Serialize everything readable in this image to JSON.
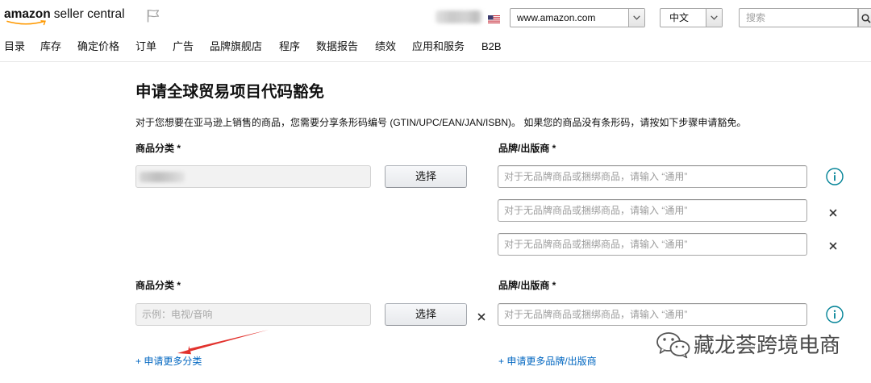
{
  "colors": {
    "link": "#0066c0",
    "info_icon": "#008296",
    "annotation_arrow": "#e2322d",
    "logo_smile": "#ff9900"
  },
  "icons": {
    "report_flag": "flag-icon",
    "marketplace_flag": "us-flag-icon",
    "dropdown": "chevron-down-icon",
    "search": "search-icon",
    "info": "info-icon",
    "remove": "close-icon",
    "watermark": "wechat-icon"
  },
  "header": {
    "logo": {
      "brand": "amazon",
      "product": "seller central"
    },
    "marketplace": "www.amazon.com",
    "language": "中文",
    "search_placeholder": "搜索"
  },
  "nav": {
    "items": [
      "目录",
      "库存",
      "确定价格",
      "订单",
      "广告",
      "品牌旗舰店",
      "程序",
      "数据报告",
      "绩效",
      "应用和服务",
      "B2B"
    ]
  },
  "page": {
    "title": "申请全球贸易项目代码豁免",
    "description": "对于您想要在亚马逊上销售的商品，您需要分享条形码编号 (GTIN/UPC/EAN/JAN/ISBN)。 如果您的商品没有条形码，请按如下步骤申请豁免。"
  },
  "form": {
    "groups": [
      {
        "category_label": "商品分类 *",
        "brand_label": "品牌/出版商 *",
        "select_button": "选择",
        "brand_inputs": [
          {
            "placeholder": "对于无品牌商品或捆绑商品，请输入 “通用”"
          },
          {
            "placeholder": "对于无品牌商品或捆绑商品，请输入 “通用”"
          },
          {
            "placeholder": "对于无品牌商品或捆绑商品，请输入 “通用”"
          }
        ]
      },
      {
        "category_label": "商品分类 *",
        "brand_label": "品牌/出版商 *",
        "category_placeholder": "示例：电视/音响",
        "select_button": "选择",
        "brand_inputs": [
          {
            "placeholder": "对于无品牌商品或捆绑商品，请输入 “通用”"
          }
        ]
      }
    ],
    "add_category_link": "+ 申请更多分类",
    "add_brand_link": "+ 申请更多品牌/出版商"
  },
  "watermark": {
    "text": "藏龙荟跨境电商"
  }
}
